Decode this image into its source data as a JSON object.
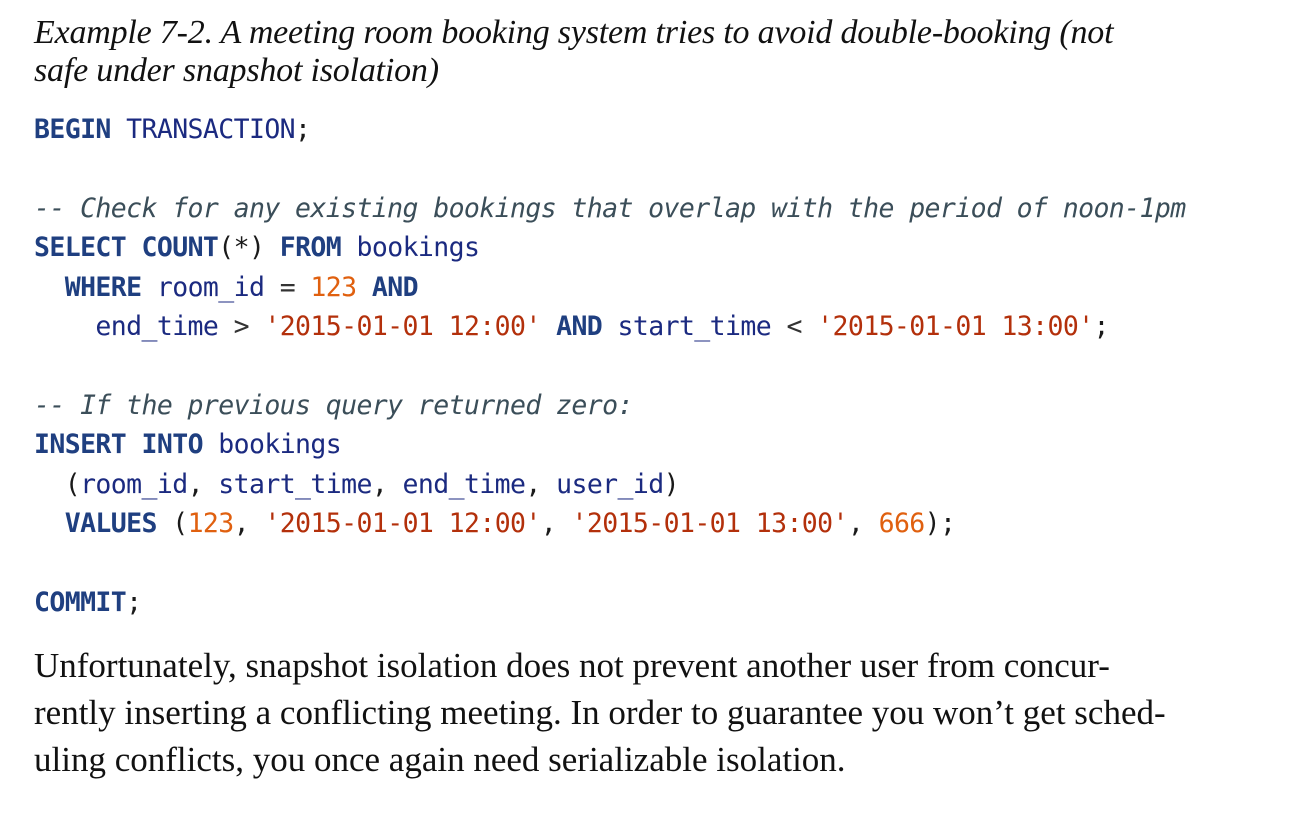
{
  "caption": {
    "line1": "Example 7-2. A meeting room booking system tries to avoid double-booking (not",
    "line2": "safe under snapshot isolation)"
  },
  "code": {
    "l1": {
      "kw1": "BEGIN",
      "id1": "TRANSACTION",
      "end": ";"
    },
    "l3": {
      "comment": "-- Check for any existing bookings that overlap with the period of noon-1pm"
    },
    "l4": {
      "kw1": "SELECT",
      "kw2": "COUNT",
      "p1": "(*)",
      "kw3": "FROM",
      "id1": "bookings"
    },
    "l5": {
      "kw1": "WHERE",
      "id1": "room_id",
      "op1": "=",
      "num1": "123",
      "kw2": "AND"
    },
    "l6": {
      "id1": "end_time",
      "op1": ">",
      "str1": "'2015-01-01 12:00'",
      "kw1": "AND",
      "id2": "start_time",
      "op2": "<",
      "str2": "'2015-01-01 13:00'",
      "end": ";"
    },
    "l8": {
      "comment": "-- If the previous query returned zero:"
    },
    "l9": {
      "kw1": "INSERT",
      "kw2": "INTO",
      "id1": "bookings"
    },
    "l10": {
      "p1": "(",
      "id1": "room_id",
      "c1": ", ",
      "id2": "start_time",
      "c2": ", ",
      "id3": "end_time",
      "c3": ", ",
      "id4": "user_id",
      "p2": ")"
    },
    "l11": {
      "kw1": "VALUES",
      "p1": "(",
      "num1": "123",
      "c1": ", ",
      "str1": "'2015-01-01 12:00'",
      "c2": ", ",
      "str2": "'2015-01-01 13:00'",
      "c3": ", ",
      "num2": "666",
      "p2": ");"
    },
    "l13": {
      "kw1": "COMMIT",
      "end": ";"
    }
  },
  "body": {
    "paragraph": "Unfortunately, snapshot isolation does not prevent another user from concurrently inserting a conflicting meeting. In order to guarantee you won’t get scheduling conflicts, you once again need serializable isolation.",
    "line1": "Unfortunately, snapshot isolation does not prevent another user from concur-",
    "line2": "rently inserting a conflicting meeting. In order to guarantee you won’t get sched-",
    "line3": "uling conflicts, you once again need serializable isolation."
  }
}
